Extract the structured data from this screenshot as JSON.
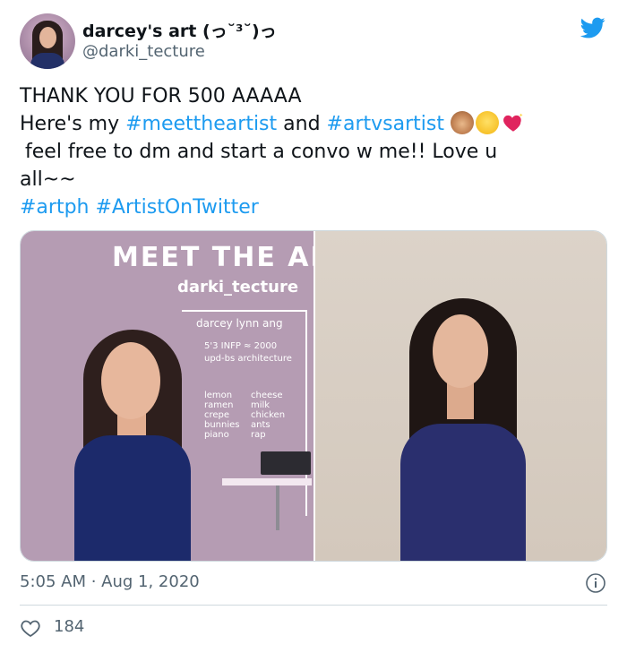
{
  "author": {
    "display_name": "darcey's art (っ˘³˘)っ",
    "handle": "@darki_tecture",
    "avatar_icon": "avatar-icon"
  },
  "platform_icon": "twitter-bird-icon",
  "tweet": {
    "line1": "THANK YOU FOR 500 AAAAA",
    "line2_prefix": "Here's my ",
    "hashtag1": "#meettheartist",
    "line2_mid": " and ",
    "hashtag2": "#artvsartist",
    "emojis": [
      "see-no-evil-monkey-emoji",
      "smiling-face-with-hearts-emoji",
      "sparkling-heart-emoji"
    ],
    "line3": "feel free to dm and start a convo w me!! Love u",
    "line4": "all~~",
    "hashtag3": "#artph",
    "hashtag4": "#ArtistOnTwitter"
  },
  "media": {
    "left_image": {
      "title": "MEET THE AR",
      "handle": "darki_tecture",
      "name": "darcey lynn ang",
      "info_line1": "5'3 INFP ≈ 2000",
      "info_line2": "upd-bs architecture",
      "likes": [
        "lemon",
        "ramen",
        "crepe",
        "bunnies",
        "piano"
      ],
      "dislikes": [
        "cheese",
        "milk",
        "chicken",
        "ants",
        "rap"
      ]
    }
  },
  "footer": {
    "timestamp": "5:05 AM · Aug 1, 2020",
    "like_count": "184"
  },
  "colors": {
    "accent": "#1d9bf0",
    "text": "#0f1419",
    "muted": "#536471",
    "border": "#cfd9de",
    "like_icon": "#536471"
  }
}
